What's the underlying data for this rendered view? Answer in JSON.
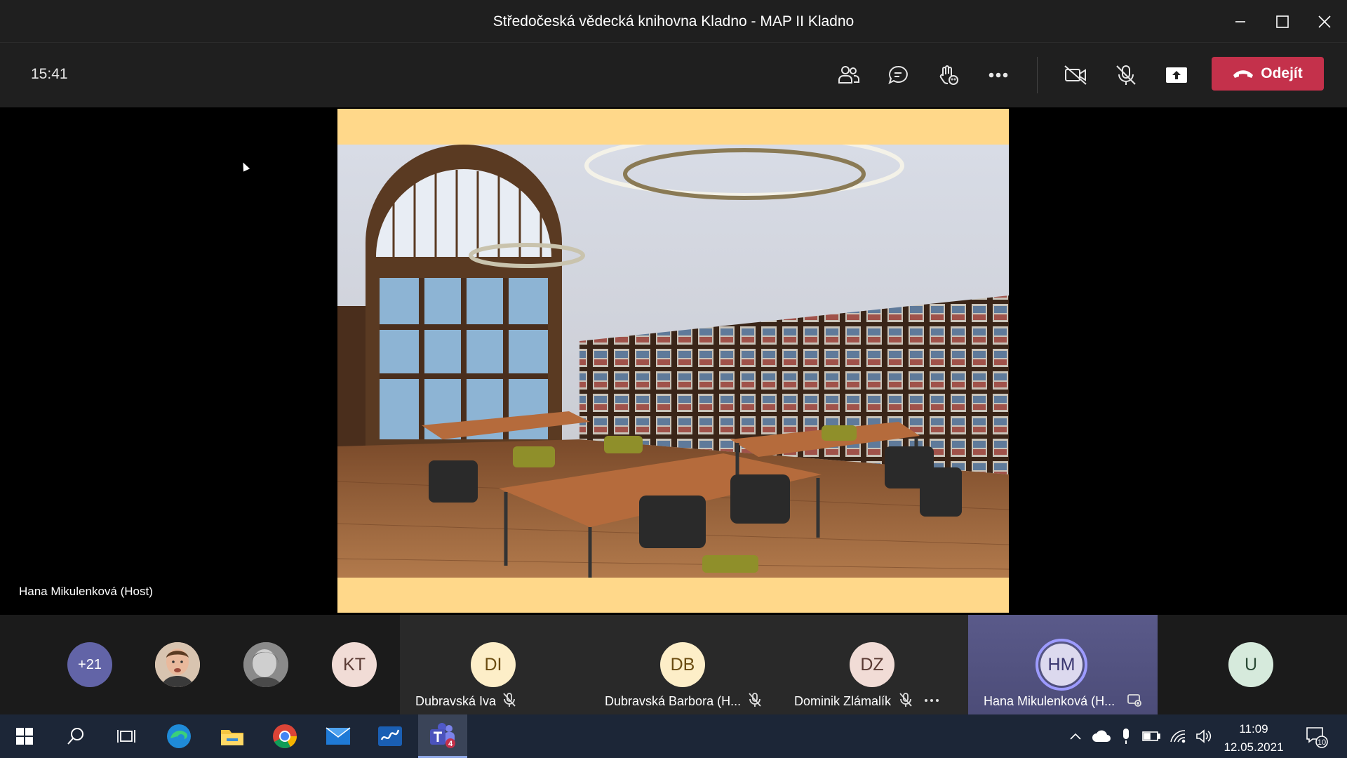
{
  "window": {
    "title": "Středočeská vědecká knihovna Kladno - MAP II Kladno"
  },
  "toolbar": {
    "elapsed_time": "15:41",
    "leave_label": "Odejít",
    "icons": [
      "people-icon",
      "chat-icon",
      "reactions-icon",
      "more-icon",
      "camera-off-icon",
      "mic-off-icon",
      "share-screen-icon"
    ],
    "leave_color": "#c4314b"
  },
  "stage": {
    "speaker_label": "Hana Mikulenková (Host)",
    "slide_background": "#ffd88a"
  },
  "participants": {
    "overflow_count": "+21",
    "avatars": [
      {
        "initials": "KT",
        "bg": "#f1dcd6",
        "fg": "#5a3a33"
      },
      {
        "initials": "U",
        "bg": "#d6eadc",
        "fg": "#2b4a36"
      }
    ],
    "tiles": [
      {
        "initials": "DI",
        "name": "Dubravská Iva",
        "bg": "#fdeec8",
        "fg": "#6a4b10",
        "muted": true
      },
      {
        "initials": "DB",
        "name": "Dubravská Barbora (H...",
        "bg": "#fdeec8",
        "fg": "#6a4b10",
        "muted": true
      },
      {
        "initials": "DZ",
        "name": "Dominik Zlámalík",
        "bg": "#f1dcd6",
        "fg": "#5a3a33",
        "muted": true
      },
      {
        "initials": "HM",
        "name": "Hana Mikulenková (H...",
        "bg": "#dcd9ee",
        "fg": "#3a3670",
        "muted": false
      }
    ]
  },
  "taskbar": {
    "apps": [
      "start-icon",
      "search-icon",
      "task-view-icon",
      "edge-icon",
      "file-explorer-icon",
      "chrome-icon",
      "mail-icon",
      "whiteboard-icon",
      "teams-icon"
    ],
    "teams_badge": "4",
    "time": "11:09",
    "date": "12.05.2021",
    "notification_count": "10"
  }
}
